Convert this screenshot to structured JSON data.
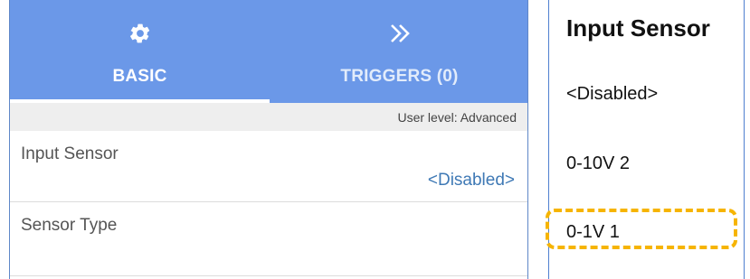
{
  "tabs": [
    {
      "label": "BASIC",
      "icon": "gear-icon"
    },
    {
      "label": "TRIGGERS (0)",
      "icon": "double-chevron-right-icon"
    }
  ],
  "user_level": "User level: Advanced",
  "settings": {
    "rows": [
      {
        "label": "Input Sensor",
        "value": "<Disabled>"
      },
      {
        "label": "Sensor Type",
        "value": ""
      }
    ]
  },
  "dropdown": {
    "title": "Input Sensor",
    "options": [
      "<Disabled>",
      "0-10V 2",
      "0-1V 1"
    ],
    "highlighted_option": "0-1V 1"
  },
  "colors": {
    "tab_bar": "#6b98e8",
    "value_text": "#3f79b5",
    "highlight": "#f6b400"
  }
}
